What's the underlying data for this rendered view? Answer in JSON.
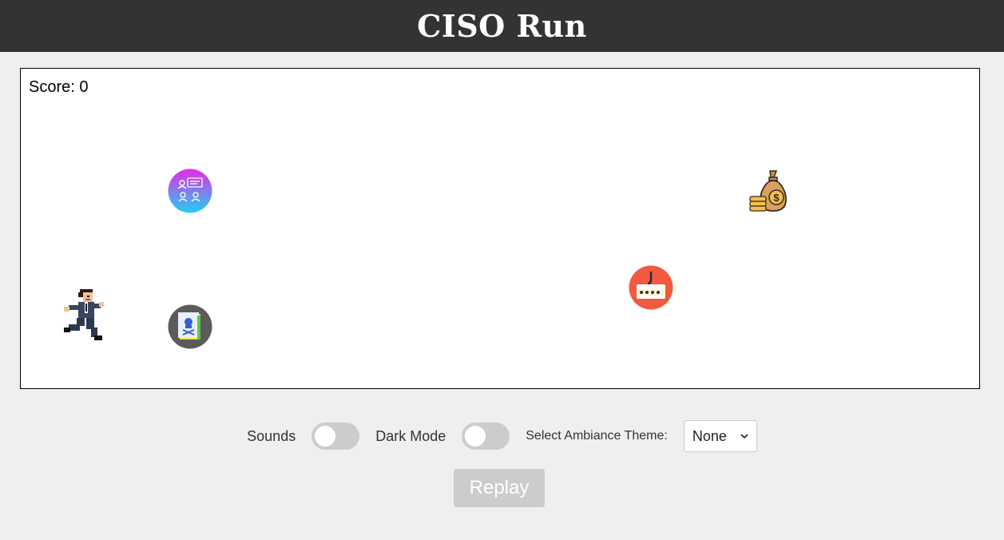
{
  "header": {
    "title": "CISO Run"
  },
  "game": {
    "score_label": "Score: 0",
    "sprites": {
      "player": "running-ciso-icon",
      "team": "team-meeting-icon",
      "money": "money-bag-icon",
      "phishing": "phishing-password-icon",
      "malware": "malware-file-icon"
    }
  },
  "controls": {
    "sounds_label": "Sounds",
    "sounds_on": false,
    "dark_mode_label": "Dark Mode",
    "dark_mode_on": false,
    "theme_label": "Select Ambiance Theme:",
    "theme_value": "None",
    "replay_label": "Replay"
  },
  "colors": {
    "header_bg": "#333333",
    "page_bg": "#efefef",
    "toggle_off": "#cccccc",
    "replay_bg": "#cccccc"
  }
}
